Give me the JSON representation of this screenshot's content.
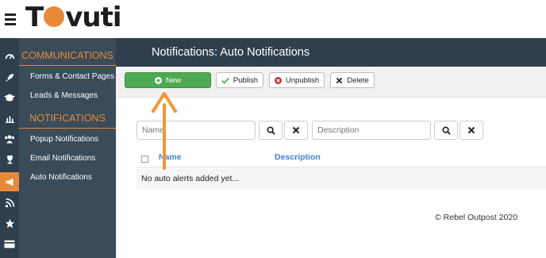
{
  "brand": {
    "logo_text_left": "T",
    "logo_text_right": "vuti",
    "logo_circle_color": "#e8893a"
  },
  "icon_rail": [
    "dashboard-icon",
    "rocket-icon",
    "graduation-cap-icon",
    "bar-chart-icon",
    "users-icon",
    "trophy-icon",
    "megaphone-icon",
    "rss-icon",
    "star-icon",
    "credit-card-icon"
  ],
  "sidebar": {
    "communications_heading": "COMMUNICATIONS",
    "forms_contact": "Forms & Contact Pages",
    "leads_messages": "Leads & Messages",
    "notifications_heading": "NOTIFICATIONS",
    "popup": "Popup Notifications",
    "email": "Email Notifications",
    "auto": "Auto Notifications"
  },
  "header": {
    "title": "Notifications: Auto Notifications"
  },
  "toolbar": {
    "new": "New",
    "publish": "Publish",
    "unpublish": "Unpublish",
    "delete": "Delete"
  },
  "filters": {
    "name_placeholder": "Name",
    "description_placeholder": "Description"
  },
  "table": {
    "col_name": "Name",
    "col_description": "Description",
    "empty_message": "No auto alerts added yet..."
  },
  "footer": {
    "copyright": "© Rebel Outpost 2020"
  },
  "colors": {
    "accent": "#e8893a",
    "sidebar_bg": "#3a4b59",
    "header_bg": "#2f3f4d",
    "new_button": "#4eaa52",
    "table_header_text": "#3f7fd1"
  }
}
